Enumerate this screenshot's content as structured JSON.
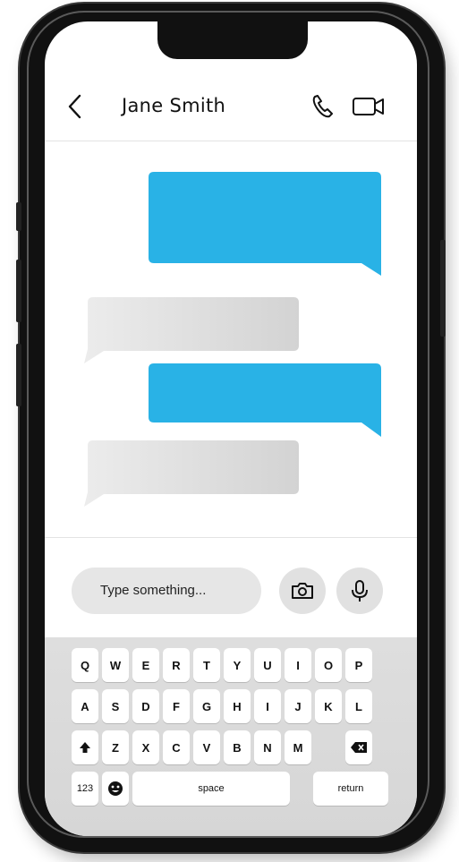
{
  "header": {
    "contact_name": "Jane Smith",
    "icons": [
      "chevron-left-icon",
      "phone-icon",
      "video-camera-icon"
    ]
  },
  "conversation": {
    "messages": [
      {
        "direction": "outgoing",
        "color": "#29B2E6"
      },
      {
        "direction": "incoming",
        "color": "#D9D9D9"
      },
      {
        "direction": "outgoing",
        "color": "#29B2E6"
      },
      {
        "direction": "incoming",
        "color": "#D9D9D9"
      }
    ]
  },
  "composer": {
    "placeholder": "Type something...",
    "icons": [
      "camera-icon",
      "microphone-icon"
    ]
  },
  "keyboard": {
    "row1": [
      "Q",
      "W",
      "E",
      "R",
      "T",
      "Y",
      "U",
      "I",
      "O",
      "P"
    ],
    "row2": [
      "A",
      "S",
      "D",
      "F",
      "G",
      "H",
      "I",
      "J",
      "K",
      "L"
    ],
    "row3": [
      "Z",
      "X",
      "C",
      "V",
      "B",
      "N",
      "M"
    ],
    "numbers_label": "123",
    "space_label": "space",
    "return_label": "return",
    "icons": [
      "shift-icon",
      "emoji-icon",
      "backspace-icon"
    ]
  },
  "colors": {
    "outgoing_bubble": "#29B2E6",
    "incoming_bubble": "#D9D9D9",
    "keyboard_bg": "#DADADA",
    "phone_frame": "#111111"
  }
}
